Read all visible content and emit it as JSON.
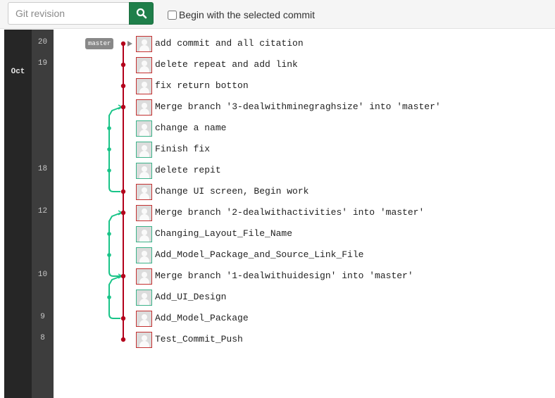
{
  "toolbar": {
    "search_placeholder": "Git revision",
    "search_icon": "search-icon",
    "option_label": "Begin with the selected commit",
    "option_checked": false,
    "search_button_color": "#1f7f4a"
  },
  "timeline": {
    "month": "Oct",
    "days": [
      "20",
      "19",
      "18",
      "12",
      "10",
      "9",
      "8"
    ]
  },
  "branch_tag": "master",
  "colors": {
    "master": "#b3001b",
    "feature": "#19c488"
  },
  "commits": [
    {
      "message": "add commit and all citation",
      "branch": "master"
    },
    {
      "message": "delete repeat and add link",
      "branch": "master"
    },
    {
      "message": "fix return botton",
      "branch": "master"
    },
    {
      "message": "Merge branch '3-dealwithminegraghsize' into 'master'",
      "branch": "master"
    },
    {
      "message": "change a name",
      "branch": "feature"
    },
    {
      "message": "Finish fix",
      "branch": "feature"
    },
    {
      "message": "delete repit",
      "branch": "feature"
    },
    {
      "message": "Change UI screen, Begin work",
      "branch": "master"
    },
    {
      "message": "Merge branch '2-dealwithactivities' into 'master'",
      "branch": "master"
    },
    {
      "message": "Changing_Layout_File_Name",
      "branch": "feature"
    },
    {
      "message": "Add_Model_Package_and_Source_Link_File",
      "branch": "feature"
    },
    {
      "message": "Merge branch '1-dealwithuidesign' into 'master'",
      "branch": "master"
    },
    {
      "message": "Add_UI_Design",
      "branch": "feature"
    },
    {
      "message": "Add_Model_Package",
      "branch": "master"
    },
    {
      "message": "Test_Commit_Push",
      "branch": "master"
    }
  ]
}
